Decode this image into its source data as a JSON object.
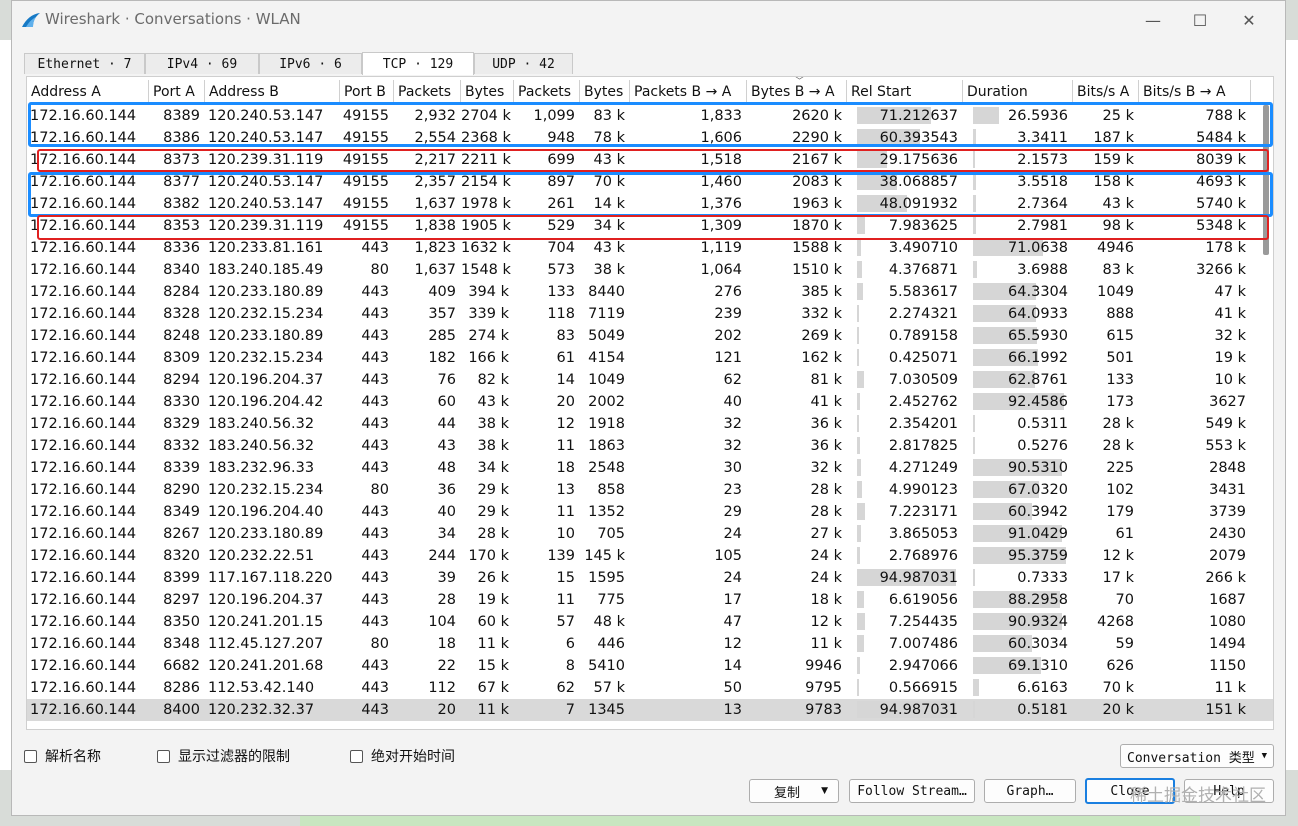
{
  "title": "Wireshark · Conversations · WLAN",
  "window_controls": {
    "minimize": "—",
    "maximize": "☐",
    "close": "✕"
  },
  "tabs": [
    {
      "label": "Ethernet · 7"
    },
    {
      "label": "IPv4 · 69"
    },
    {
      "label": "IPv6 · 6"
    },
    {
      "label": "TCP · 129"
    },
    {
      "label": "UDP · 42"
    }
  ],
  "columns": [
    "Address A",
    "Port A",
    "Address B",
    "Port B",
    "Packets",
    "Bytes",
    "Packets",
    "Bytes",
    "Packets B → A",
    "Bytes B → A",
    "Rel Start",
    "Duration",
    "Bits/s A",
    "Bits/s B → A"
  ],
  "rows": [
    [
      "172.16.60.144",
      "8389",
      "120.240.53.147",
      "49155",
      "2,932",
      "2704 k",
      "1,099",
      "83 k",
      "1,833",
      "2620 k",
      "71.212637",
      "26.5936",
      "25 k",
      "788 k"
    ],
    [
      "172.16.60.144",
      "8386",
      "120.240.53.147",
      "49155",
      "2,554",
      "2368 k",
      "948",
      "78 k",
      "1,606",
      "2290 k",
      "60.393543",
      "3.3411",
      "187 k",
      "5484 k"
    ],
    [
      "172.16.60.144",
      "8373",
      "120.239.31.119",
      "49155",
      "2,217",
      "2211 k",
      "699",
      "43 k",
      "1,518",
      "2167 k",
      "29.175636",
      "2.1573",
      "159 k",
      "8039 k"
    ],
    [
      "172.16.60.144",
      "8377",
      "120.240.53.147",
      "49155",
      "2,357",
      "2154 k",
      "897",
      "70 k",
      "1,460",
      "2083 k",
      "38.068857",
      "3.5518",
      "158 k",
      "4693 k"
    ],
    [
      "172.16.60.144",
      "8382",
      "120.240.53.147",
      "49155",
      "1,637",
      "1978 k",
      "261",
      "14 k",
      "1,376",
      "1963 k",
      "48.091932",
      "2.7364",
      "43 k",
      "5740 k"
    ],
    [
      "172.16.60.144",
      "8353",
      "120.239.31.119",
      "49155",
      "1,838",
      "1905 k",
      "529",
      "34 k",
      "1,309",
      "1870 k",
      "7.983625",
      "2.7981",
      "98 k",
      "5348 k"
    ],
    [
      "172.16.60.144",
      "8336",
      "120.233.81.161",
      "443",
      "1,823",
      "1632 k",
      "704",
      "43 k",
      "1,119",
      "1588 k",
      "3.490710",
      "71.0638",
      "4946",
      "178 k"
    ],
    [
      "172.16.60.144",
      "8340",
      "183.240.185.49",
      "80",
      "1,637",
      "1548 k",
      "573",
      "38 k",
      "1,064",
      "1510 k",
      "4.376871",
      "3.6988",
      "83 k",
      "3266 k"
    ],
    [
      "172.16.60.144",
      "8284",
      "120.233.180.89",
      "443",
      "409",
      "394 k",
      "133",
      "8440",
      "276",
      "385 k",
      "5.583617",
      "64.3304",
      "1049",
      "47 k"
    ],
    [
      "172.16.60.144",
      "8328",
      "120.232.15.234",
      "443",
      "357",
      "339 k",
      "118",
      "7119",
      "239",
      "332 k",
      "2.274321",
      "64.0933",
      "888",
      "41 k"
    ],
    [
      "172.16.60.144",
      "8248",
      "120.233.180.89",
      "443",
      "285",
      "274 k",
      "83",
      "5049",
      "202",
      "269 k",
      "0.789158",
      "65.5930",
      "615",
      "32 k"
    ],
    [
      "172.16.60.144",
      "8309",
      "120.232.15.234",
      "443",
      "182",
      "166 k",
      "61",
      "4154",
      "121",
      "162 k",
      "0.425071",
      "66.1992",
      "501",
      "19 k"
    ],
    [
      "172.16.60.144",
      "8294",
      "120.196.204.37",
      "443",
      "76",
      "82 k",
      "14",
      "1049",
      "62",
      "81 k",
      "7.030509",
      "62.8761",
      "133",
      "10 k"
    ],
    [
      "172.16.60.144",
      "8330",
      "120.196.204.42",
      "443",
      "60",
      "43 k",
      "20",
      "2002",
      "40",
      "41 k",
      "2.452762",
      "92.4586",
      "173",
      "3627"
    ],
    [
      "172.16.60.144",
      "8329",
      "183.240.56.32",
      "443",
      "44",
      "38 k",
      "12",
      "1918",
      "32",
      "36 k",
      "2.354201",
      "0.5311",
      "28 k",
      "549 k"
    ],
    [
      "172.16.60.144",
      "8332",
      "183.240.56.32",
      "443",
      "43",
      "38 k",
      "11",
      "1863",
      "32",
      "36 k",
      "2.817825",
      "0.5276",
      "28 k",
      "553 k"
    ],
    [
      "172.16.60.144",
      "8339",
      "183.232.96.33",
      "443",
      "48",
      "34 k",
      "18",
      "2548",
      "30",
      "32 k",
      "4.271249",
      "90.5310",
      "225",
      "2848"
    ],
    [
      "172.16.60.144",
      "8290",
      "120.232.15.234",
      "80",
      "36",
      "29 k",
      "13",
      "858",
      "23",
      "28 k",
      "4.990123",
      "67.0320",
      "102",
      "3431"
    ],
    [
      "172.16.60.144",
      "8349",
      "120.196.204.40",
      "443",
      "40",
      "29 k",
      "11",
      "1352",
      "29",
      "28 k",
      "7.223171",
      "60.3942",
      "179",
      "3739"
    ],
    [
      "172.16.60.144",
      "8267",
      "120.233.180.89",
      "443",
      "34",
      "28 k",
      "10",
      "705",
      "24",
      "27 k",
      "3.865053",
      "91.0429",
      "61",
      "2430"
    ],
    [
      "172.16.60.144",
      "8320",
      "120.232.22.51",
      "443",
      "244",
      "170 k",
      "139",
      "145 k",
      "105",
      "24 k",
      "2.768976",
      "95.3759",
      "12 k",
      "2079"
    ],
    [
      "172.16.60.144",
      "8399",
      "117.167.118.220",
      "443",
      "39",
      "26 k",
      "15",
      "1595",
      "24",
      "24 k",
      "94.987031",
      "0.7333",
      "17 k",
      "266 k"
    ],
    [
      "172.16.60.144",
      "8297",
      "120.196.204.37",
      "443",
      "28",
      "19 k",
      "11",
      "775",
      "17",
      "18 k",
      "6.619056",
      "88.2958",
      "70",
      "1687"
    ],
    [
      "172.16.60.144",
      "8350",
      "120.241.201.15",
      "443",
      "104",
      "60 k",
      "57",
      "48 k",
      "47",
      "12 k",
      "7.254435",
      "90.9324",
      "4268",
      "1080"
    ],
    [
      "172.16.60.144",
      "8348",
      "112.45.127.207",
      "80",
      "18",
      "11 k",
      "6",
      "446",
      "12",
      "11 k",
      "7.007486",
      "60.3034",
      "59",
      "1494"
    ],
    [
      "172.16.60.144",
      "6682",
      "120.241.201.68",
      "443",
      "22",
      "15 k",
      "8",
      "5410",
      "14",
      "9946",
      "2.947066",
      "69.1310",
      "626",
      "1150"
    ],
    [
      "172.16.60.144",
      "8286",
      "112.53.42.140",
      "443",
      "112",
      "67 k",
      "62",
      "57 k",
      "50",
      "9795",
      "0.566915",
      "6.6163",
      "70 k",
      "11 k"
    ],
    [
      "172.16.60.144",
      "8400",
      "120.232.32.37",
      "443",
      "20",
      "11 k",
      "7",
      "1345",
      "13",
      "9783",
      "94.987031",
      "0.5181",
      "20 k",
      "151 k"
    ]
  ],
  "duration_bars": [
    [
      71.21,
      26.59
    ],
    [
      60.39,
      3.34
    ],
    [
      29.18,
      2.16
    ],
    [
      38.07,
      3.55
    ],
    [
      48.09,
      2.74
    ],
    [
      7.98,
      2.8
    ],
    [
      3.49,
      71.06
    ],
    [
      4.38,
      3.7
    ],
    [
      5.58,
      64.33
    ],
    [
      2.27,
      64.09
    ],
    [
      0.79,
      65.59
    ],
    [
      0.43,
      66.2
    ],
    [
      7.03,
      62.88
    ],
    [
      2.45,
      92.46
    ],
    [
      2.35,
      0.53
    ],
    [
      2.82,
      0.53
    ],
    [
      4.27,
      90.53
    ],
    [
      4.99,
      67.03
    ],
    [
      7.22,
      60.39
    ],
    [
      3.87,
      91.04
    ],
    [
      2.77,
      95.38
    ],
    [
      94.99,
      0.73
    ],
    [
      6.62,
      88.3
    ],
    [
      7.25,
      90.93
    ],
    [
      7.01,
      60.3
    ],
    [
      2.95,
      69.13
    ],
    [
      0.57,
      6.62
    ],
    [
      94.99,
      0.52
    ]
  ],
  "selected_row": 27,
  "options": [
    {
      "label": "解析名称"
    },
    {
      "label": "显示过滤器的限制"
    },
    {
      "label": "绝对开始时间"
    }
  ],
  "conversation_type": "Conversation 类型",
  "buttons": {
    "copy": "复制",
    "follow_stream": "Follow Stream…",
    "graph": "Graph…",
    "close": "Close",
    "help": "Help"
  },
  "watermark": "稀土掘金技术社区",
  "colors": {
    "blue_highlight": "#1a8cff",
    "red_highlight": "#e02020",
    "accent": "#1a7fe0"
  }
}
